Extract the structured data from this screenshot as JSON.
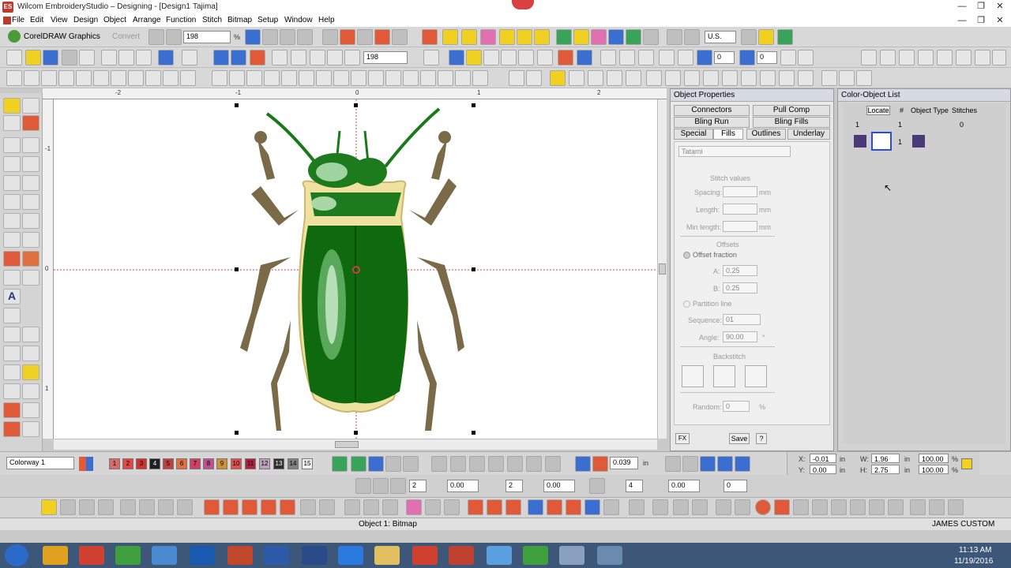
{
  "window": {
    "title": "Wilcom EmbroideryStudio – Designing - [Design1",
    "machine": "Tajima]"
  },
  "menu": [
    "File",
    "Edit",
    "View",
    "Design",
    "Object",
    "Arrange",
    "Function",
    "Stitch",
    "Bitmap",
    "Setup",
    "Window",
    "Help"
  ],
  "toolbar1": {
    "corel_label": "CorelDRAW Graphics",
    "convert_label": "Convert",
    "zoom_value": "198",
    "zoom_unit": "%",
    "unit_select": "U.S."
  },
  "toolbar2": {
    "zoom_value": "198",
    "angle1": "0",
    "angle2": "0"
  },
  "rulers": {
    "h_ticks": [
      "-2",
      "-1",
      "0",
      "1",
      "2"
    ],
    "v_ticks": [
      "-1",
      "0",
      "1",
      "-1"
    ]
  },
  "object_properties": {
    "title": "Object Properties",
    "tabs_row1": [
      "Connectors",
      "Pull Comp"
    ],
    "tabs_row2": [
      "Bling Run",
      "Bling Fills"
    ],
    "tabs_row3": [
      "Special",
      "Fills",
      "Outlines",
      "Underlay"
    ],
    "fill_type": "Tatami",
    "stitch_values_label": "Stitch values",
    "spacing_label": "Spacing:",
    "length_label": "Length:",
    "min_length_label": "Min length:",
    "unit_mm": "mm",
    "offsets_label": "Offsets",
    "offset_fraction_label": "Offset fraction",
    "a_label": "A:",
    "a_value": "0.25",
    "b_label": "B:",
    "b_value": "0.25",
    "partition_line_label": "Partition line",
    "sequence_label": "Sequence:",
    "sequence_value": "01",
    "angle_label": "Angle:",
    "angle_value": "90.00",
    "angle_unit": "°",
    "backstitch_label": "Backstitch",
    "random_label": "Random:",
    "random_value": "0",
    "percent": "%",
    "fx_label": "FX",
    "save_label": "Save",
    "help_label": "?"
  },
  "color_object_list": {
    "title": "Color-Object List",
    "locate_label": "Locate",
    "col_num": "#",
    "col_object_type": "Object Type",
    "col_stitches": "Stitches",
    "row1": {
      "color": "1",
      "num": "1",
      "stitches": "0"
    },
    "row2": {
      "num": "1"
    }
  },
  "colorway": {
    "value": "Colorway 1",
    "swatches": [
      "1",
      "2",
      "3",
      "4",
      "5",
      "6",
      "7",
      "8",
      "9",
      "10",
      "11",
      "12",
      "13",
      "14",
      "15"
    ],
    "swatch_colors": [
      "#d86a6a",
      "#e04848",
      "#d03030",
      "#202020",
      "#c04040",
      "#e07040",
      "#d04060",
      "#c05090",
      "#d09030",
      "#e05050",
      "#b02040",
      "#c0a0c0",
      "#303030",
      "#808080",
      "#f0f0f0"
    ],
    "spin_value": "0.039",
    "spin_unit": "in"
  },
  "position": {
    "x_label": "X:",
    "x_value": "-0.01",
    "y_label": "Y:",
    "y_value": "0.00",
    "w_label": "W:",
    "w_value": "1.96",
    "h_label": "H:",
    "h_value": "2.75",
    "unit": "in",
    "sw_value": "100.00",
    "sh_value": "100.00",
    "pct": "%"
  },
  "toolbar_bottom": {
    "v1": "2",
    "v2": "0.00",
    "v3": "2",
    "v4": "0.00",
    "v5": "4",
    "v6": "0.00",
    "v7": "0"
  },
  "status": {
    "center": "Object 1: Bitmap",
    "right": "JAMES CUSTOM"
  },
  "taskbar": {
    "time": "11:13 AM",
    "date": "11/19/2016"
  }
}
